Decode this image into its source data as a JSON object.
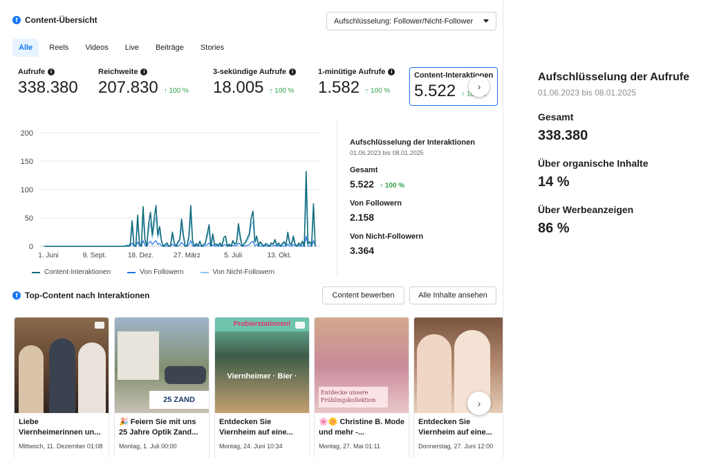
{
  "overview": {
    "title": "Content-Übersicht",
    "dropdown": "Aufschlüsselung: Follower/Nicht-Follower",
    "tabs": [
      "Alle",
      "Reels",
      "Videos",
      "Live",
      "Beiträge",
      "Stories"
    ],
    "active_tab": "Alle"
  },
  "metrics": [
    {
      "label": "Aufrufe",
      "value": "338.380",
      "trend": ""
    },
    {
      "label": "Reichweite",
      "value": "207.830",
      "trend": "↑ 100 %"
    },
    {
      "label": "3-sekündige Aufrufe",
      "value": "18.005",
      "trend": "↑ 100 %"
    },
    {
      "label": "1-minütige Aufrufe",
      "value": "1.582",
      "trend": "↑ 100 %"
    },
    {
      "label": "Content-Interaktionen",
      "value": "5.522",
      "trend": "↑ 100 %"
    }
  ],
  "chart_data": {
    "type": "line",
    "title": "",
    "xlabel": "",
    "ylabel": "",
    "ylim": [
      0,
      200
    ],
    "yticks": [
      0,
      50,
      100,
      150,
      200
    ],
    "xtick_labels": [
      "1. Juni",
      "9. Sept.",
      "18. Dez.",
      "27. März",
      "5. Juli",
      "13. Okt."
    ],
    "grid": true,
    "legend_position": "bottom",
    "series": [
      {
        "name": "Content-Interaktionen",
        "color": "#0f6b7a",
        "values": [
          0,
          0,
          0,
          0,
          0,
          0,
          0,
          0,
          0,
          0,
          0,
          0,
          0,
          0,
          0,
          0,
          0,
          0,
          0,
          0,
          0,
          0,
          0,
          0,
          0,
          0,
          0,
          0,
          0,
          0,
          0,
          0,
          0,
          0,
          0,
          0,
          0,
          0,
          0,
          0,
          0,
          0,
          0,
          0,
          0,
          2,
          0,
          5,
          45,
          2,
          0,
          55,
          5,
          0,
          70,
          12,
          0,
          40,
          60,
          20,
          48,
          72,
          20,
          35,
          10,
          0,
          3,
          6,
          0,
          2,
          25,
          6,
          0,
          8,
          12,
          48,
          20,
          0,
          2,
          18,
          72,
          10,
          0,
          5,
          1,
          9,
          0,
          3,
          6,
          22,
          38,
          0,
          22,
          3,
          4,
          2,
          6,
          0,
          15,
          18,
          0,
          4,
          0,
          10,
          4,
          6,
          40,
          18,
          0,
          4,
          8,
          15,
          22,
          50,
          62,
          8,
          18,
          2,
          8,
          3,
          1,
          5,
          3,
          0,
          6,
          4,
          12,
          2,
          6,
          0,
          5,
          8,
          2,
          25,
          6,
          3,
          18,
          4,
          0,
          6,
          2,
          9,
          0,
          132,
          5,
          8,
          2,
          75,
          0
        ]
      },
      {
        "name": "Von Followern",
        "color": "#1b74e4",
        "values": [
          0,
          0,
          0,
          0,
          0,
          0,
          0,
          0,
          0,
          0,
          0,
          0,
          0,
          0,
          0,
          0,
          0,
          0,
          0,
          0,
          0,
          0,
          0,
          0,
          0,
          0,
          0,
          0,
          0,
          0,
          0,
          0,
          0,
          0,
          0,
          0,
          0,
          0,
          0,
          0,
          0,
          0,
          0,
          0,
          0,
          0,
          0,
          1,
          6,
          0,
          0,
          8,
          1,
          0,
          10,
          2,
          0,
          6,
          9,
          3,
          7,
          10,
          3,
          5,
          1,
          0,
          0,
          1,
          0,
          0,
          4,
          1,
          0,
          1,
          2,
          7,
          3,
          0,
          0,
          3,
          10,
          1,
          0,
          1,
          0,
          1,
          0,
          0,
          1,
          3,
          6,
          0,
          3,
          0,
          1,
          0,
          1,
          0,
          2,
          3,
          0,
          1,
          0,
          2,
          1,
          1,
          6,
          3,
          0,
          1,
          1,
          2,
          3,
          7,
          9,
          1,
          3,
          0,
          1,
          0,
          0,
          1,
          0,
          0,
          1,
          1,
          2,
          0,
          1,
          0,
          1,
          1,
          0,
          4,
          1,
          0,
          3,
          1,
          0,
          1,
          0,
          1,
          0,
          18,
          1,
          1,
          0,
          10,
          0
        ]
      },
      {
        "name": "Von Nicht-Followern",
        "color": "#8fc3ef",
        "values": [
          0,
          0,
          0,
          0,
          0,
          0,
          0,
          0,
          0,
          0,
          0,
          0,
          0,
          0,
          0,
          0,
          0,
          0,
          0,
          0,
          0,
          0,
          0,
          0,
          0,
          0,
          0,
          0,
          0,
          0,
          0,
          0,
          0,
          0,
          0,
          0,
          0,
          0,
          0,
          0,
          0,
          0,
          0,
          0,
          0,
          1,
          0,
          3,
          30,
          1,
          0,
          38,
          3,
          0,
          50,
          8,
          0,
          28,
          42,
          14,
          34,
          52,
          14,
          25,
          7,
          0,
          2,
          4,
          0,
          1,
          18,
          4,
          0,
          5,
          8,
          34,
          14,
          0,
          1,
          12,
          52,
          7,
          0,
          3,
          1,
          6,
          0,
          2,
          4,
          16,
          27,
          0,
          16,
          2,
          3,
          1,
          4,
          0,
          10,
          12,
          0,
          3,
          0,
          7,
          3,
          4,
          28,
          12,
          0,
          3,
          6,
          10,
          16,
          36,
          44,
          6,
          12,
          1,
          6,
          2,
          1,
          3,
          2,
          0,
          4,
          3,
          8,
          1,
          4,
          0,
          3,
          6,
          1,
          18,
          4,
          2,
          12,
          3,
          0,
          4,
          1,
          6,
          0,
          95,
          3,
          6,
          1,
          55,
          0
        ]
      }
    ]
  },
  "interactions": {
    "title": "Aufschlüsselung der Interaktionen",
    "date": "01.06.2023 bis 08.01.2025",
    "total_label": "Gesamt",
    "total_value": "5.522",
    "total_trend": "↑ 100 %",
    "followers_label": "Von Followern",
    "followers_value": "2.158",
    "nonfollowers_label": "Von Nicht-Followern",
    "nonfollowers_value": "3.364"
  },
  "top_content": {
    "title": "Top-Content nach Interaktionen",
    "promote_button": "Content bewerben",
    "all_button": "Alle Inhalte ansehen",
    "cards": [
      {
        "title": "Liebe Viernheimerinnen un...",
        "date": "Mittwoch, 11. Dezember 01:08",
        "thumb_text": "",
        "thumb_color": "#6b4a35"
      },
      {
        "title": "🎉 Feiern Sie mit uns 25 Jahre Optik Zand...",
        "date": "Montag, 1. Juli 00:00",
        "thumb_text": "25 ZAND",
        "thumb_color": "#7a8a6a"
      },
      {
        "title": "Entdecken Sie Viernheim auf eine...",
        "date": "Montag, 24. Juni 10:34",
        "thumb_text": "Viernheimer · Bier ·",
        "top_text": "Probierstationen!",
        "thumb_color": "#3d5c48"
      },
      {
        "title": "🌸🌼 Christine B. Mode und mehr -...",
        "date": "Montag, 27. Mai 01:11",
        "thumb_text": "Entdecke unsere Frühlingskollektion",
        "thumb_color": "#c98a9a"
      },
      {
        "title": "Entdecken Sie Viernheim auf eine...",
        "date": "Donnerstag, 27. Juni 12:00",
        "thumb_text": "",
        "thumb_color": "#9a7560"
      }
    ]
  },
  "breakdown": {
    "title": "Aufschlüsselung der Aufrufe",
    "date": "01.06.2023 bis 08.01.2025",
    "total_label": "Gesamt",
    "total_value": "338.380",
    "organic_label": "Über organische Inhalte",
    "organic_value": "14 %",
    "ads_label": "Über Werbeanzeigen",
    "ads_value": "86 %"
  }
}
